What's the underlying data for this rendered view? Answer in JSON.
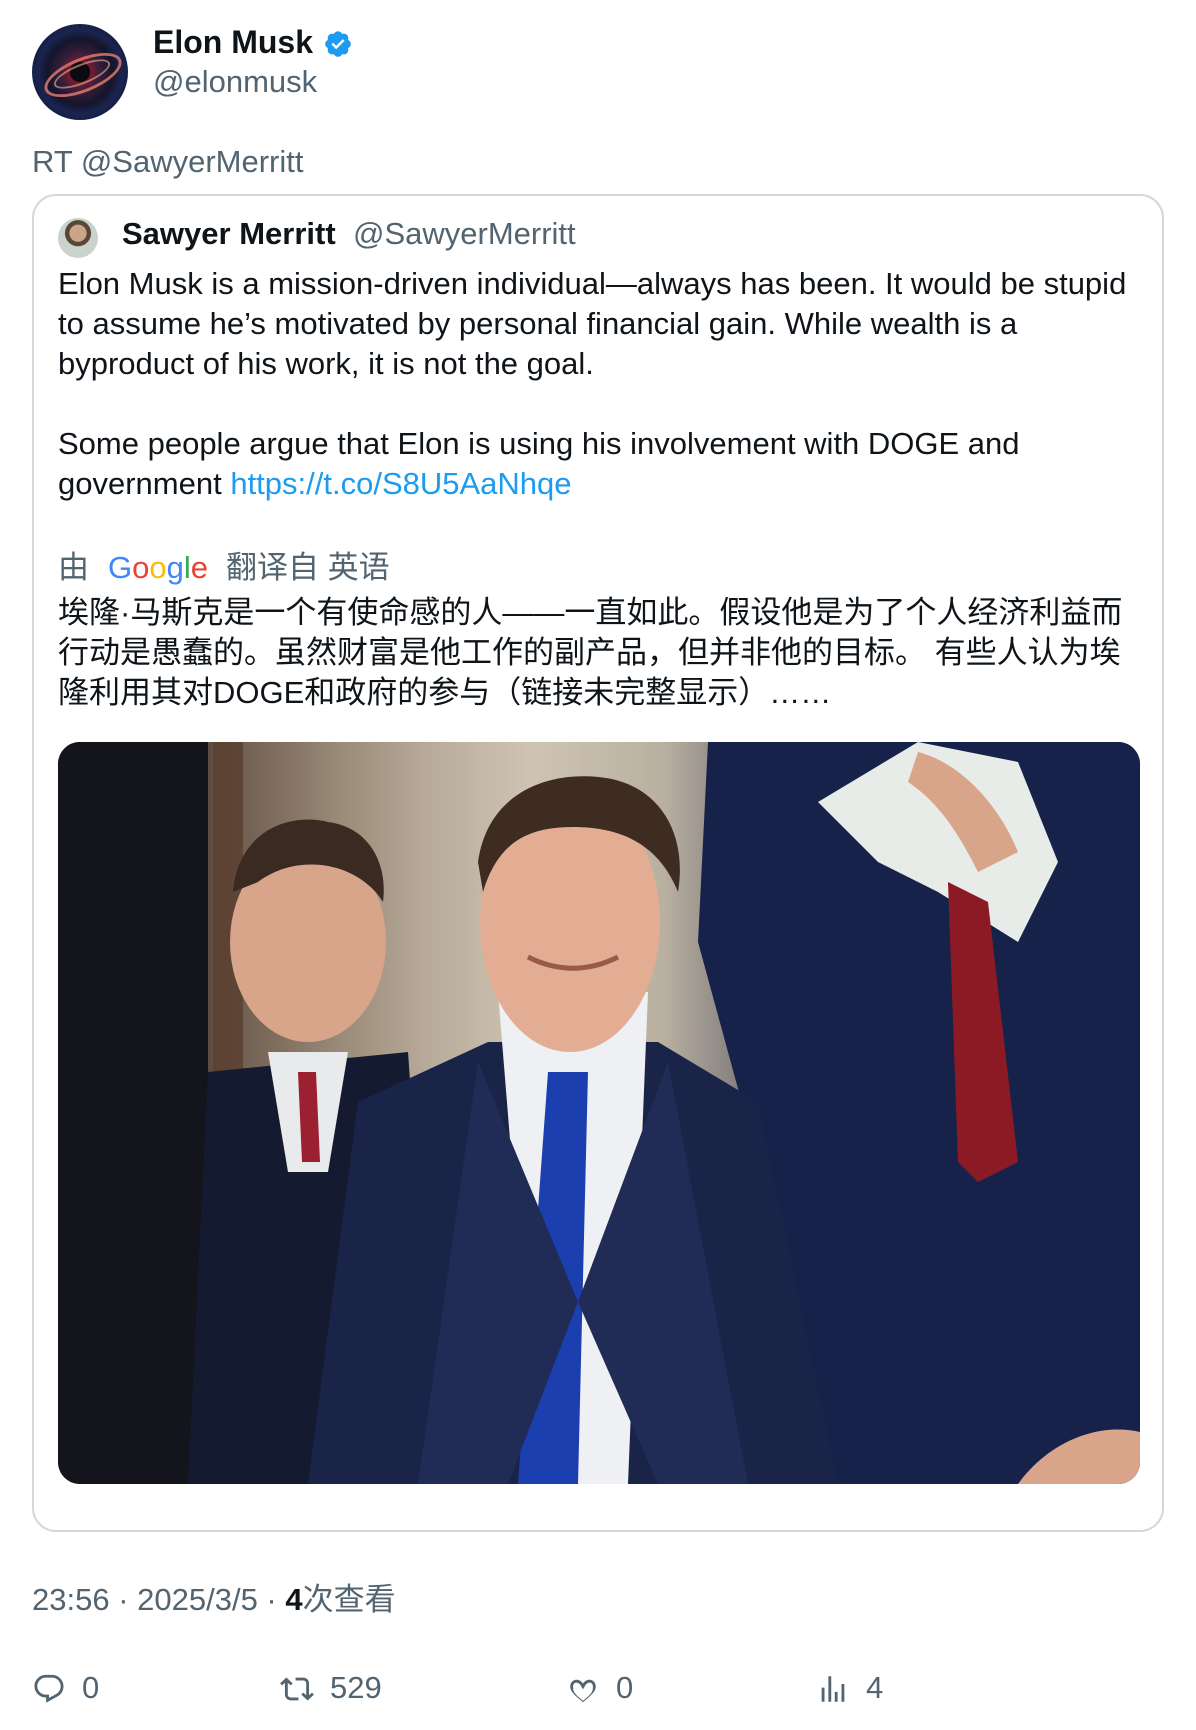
{
  "author": {
    "name": "Elon Musk",
    "handle": "@elonmusk",
    "verified": true
  },
  "retweet_line": "RT @SawyerMerritt",
  "quote": {
    "name": "Sawyer Merritt",
    "handle": "@SawyerMerritt",
    "text": "Elon Musk is a mission-driven individual—always has been. It would be stupid to assume he’s motivated by personal financial gain. While wealth is a byproduct of his work, it is not the goal.\n\nSome people argue that Elon is using his involvement with DOGE and government ",
    "link": "https://t.co/S8U5AaNhqe",
    "translation": {
      "by": "由",
      "provider": "Google",
      "rest": "翻译自 英语",
      "text": "埃隆·马斯克是一个有使命感的人——一直如此。假设他是为了个人经济利益而行动是愚蠢的。虽然财富是他工作的副产品，但并非他的目标。 有些人认为埃隆利用其对DOGE和政府的参与（链接未完整显示）……"
    }
  },
  "meta": {
    "time": "23:56",
    "date": "2025/3/5",
    "views_count": "4",
    "views_label": "次查看"
  },
  "actions": {
    "replies": "0",
    "retweets": "529",
    "likes": "0",
    "views": "4"
  },
  "colors": {
    "accent": "#1d9bf0",
    "secondary_text": "#536471",
    "border": "#cfd9de"
  }
}
